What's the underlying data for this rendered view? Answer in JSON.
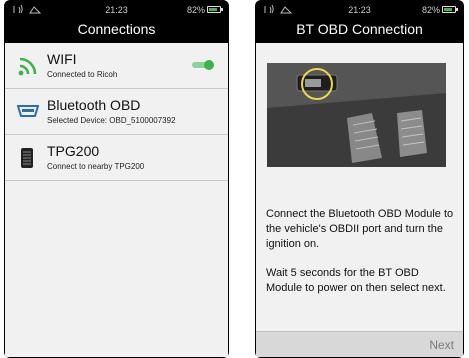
{
  "left_screen": {
    "status": {
      "time": "21:23",
      "battery": "82%",
      "battery_level": 0.82
    },
    "title": "Connections",
    "items": [
      {
        "title": "WIFI",
        "subtitle": "Connected to Ricoh",
        "icon": "wifi-icon",
        "toggle_on": true
      },
      {
        "title": "Bluetooth OBD",
        "subtitle": "Selected Device: OBD_5100007392",
        "icon": "obd-connector-icon"
      },
      {
        "title": "TPG200",
        "subtitle": "Connect to nearby TPG200",
        "icon": "tpg200-device-icon"
      }
    ]
  },
  "right_screen": {
    "status": {
      "time": "21:23",
      "battery": "82%",
      "battery_level": 0.82
    },
    "title": "BT OBD Connection",
    "instructions": [
      "Connect the Bluetooth OBD Module to the vehicle's OBDII port and turn the ignition on.",
      "Wait 5 seconds for the BT OBD Module to power on then select next."
    ],
    "next_label": "Next"
  },
  "colors": {
    "accent_green": "#3cb44b",
    "obd_blue": "#2a6db5",
    "highlight_yellow": "#e8d84a",
    "screen_bg": "#f1f1f1",
    "frame": "#000000"
  }
}
